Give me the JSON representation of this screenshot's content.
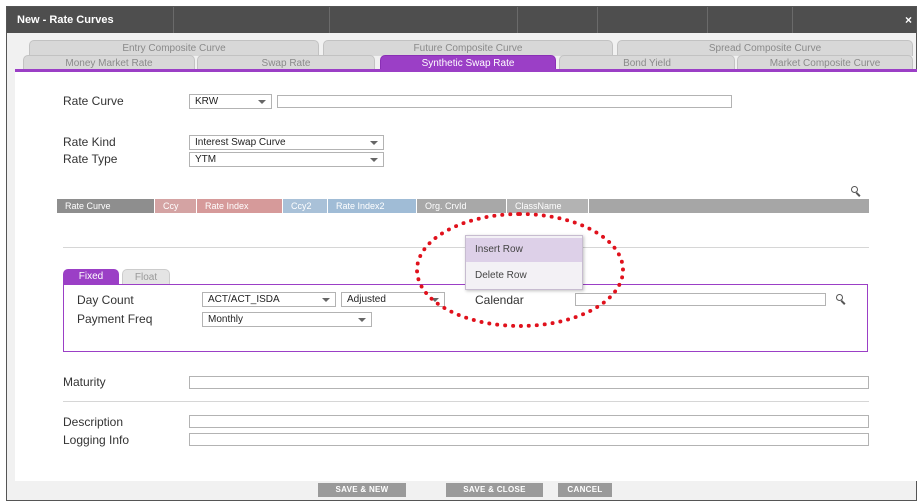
{
  "window": {
    "title": "New - Rate Curves",
    "close_glyph": "×"
  },
  "tabs_top": [
    {
      "label": "Entry Composite Curve"
    },
    {
      "label": "Future Composite Curve"
    },
    {
      "label": "Spread Composite Curve"
    }
  ],
  "tabs_bottom": [
    {
      "label": "Money Market Rate"
    },
    {
      "label": "Swap Rate"
    },
    {
      "label": "Synthetic Swap Rate",
      "active": true
    },
    {
      "label": "Bond Yield"
    },
    {
      "label": "Market Composite Curve"
    }
  ],
  "form": {
    "rate_curve": {
      "label": "Rate Curve",
      "value": "KRW",
      "text": ""
    },
    "rate_kind": {
      "label": "Rate Kind",
      "value": "Interest Swap Curve"
    },
    "rate_type": {
      "label": "Rate Type",
      "value": "YTM"
    }
  },
  "grid": {
    "columns": [
      "Rate Curve",
      "Ccy",
      "Rate Index",
      "Ccy2",
      "Rate Index2",
      "Org. CrvId",
      "ClassName"
    ],
    "search_icon": "search-icon"
  },
  "context_menu": {
    "items": [
      "Insert Row",
      "Delete Row"
    ]
  },
  "subtabs": [
    "Fixed",
    "Float"
  ],
  "fixed": {
    "day_count": {
      "label": "Day Count",
      "value": "ACT/ACT_ISDA"
    },
    "adjust": {
      "value": "Adjusted"
    },
    "calendar": {
      "label": "Calendar",
      "value": ""
    },
    "payment_freq": {
      "label": "Payment Freq",
      "value": "Monthly"
    }
  },
  "maturity": {
    "label": "Maturity",
    "value": ""
  },
  "description": {
    "label": "Description",
    "value": ""
  },
  "logging_info": {
    "label": "Logging Info",
    "value": ""
  },
  "buttons": {
    "save_new": "SAVE & NEW",
    "save_close": "SAVE & CLOSE",
    "cancel": "CANCEL"
  },
  "colors": {
    "accent": "#9b3fc6",
    "titlebar": "#4e4e4e",
    "annotation": "#e0111c"
  }
}
